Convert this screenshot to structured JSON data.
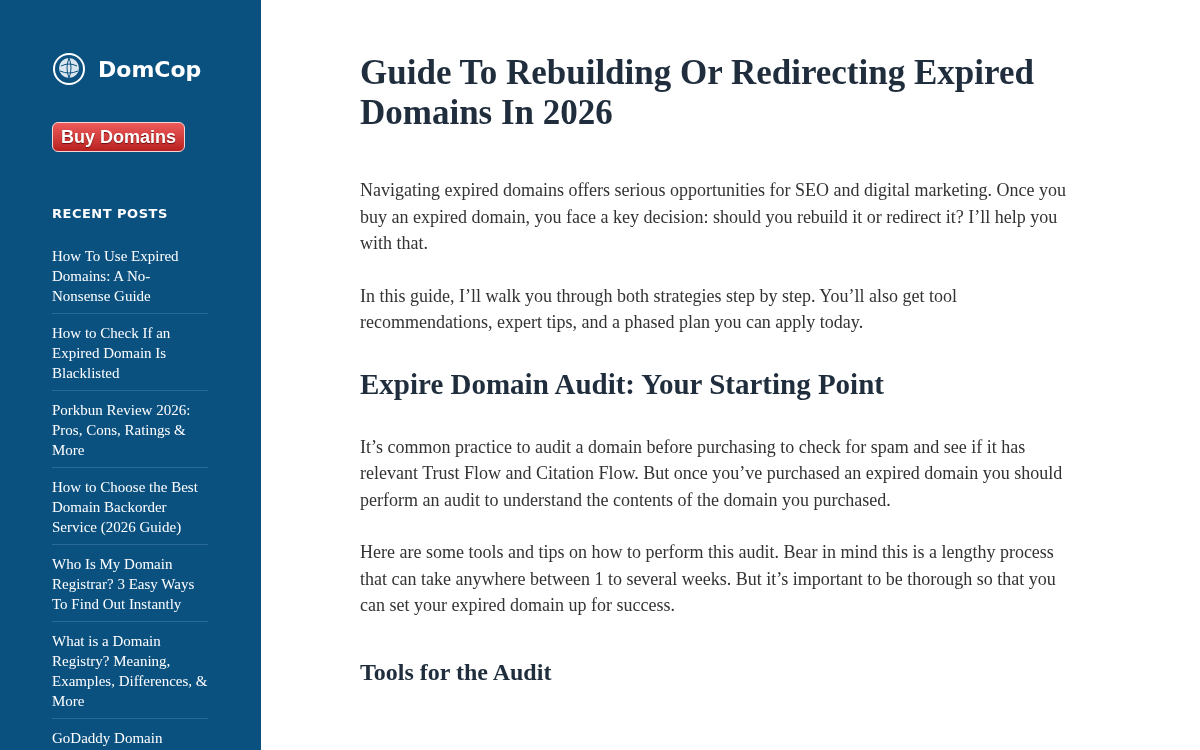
{
  "sidebar": {
    "brand": "DomCop",
    "cta_button": "Buy Domains",
    "recent_posts_heading": "RECENT POSTS",
    "recent_posts": [
      "How To Use Expired Domains: A No-Nonsense Guide",
      "How to Check If an Expired Domain Is Blacklisted",
      "Porkbun Review 2026: Pros, Cons, Ratings & More",
      "How to Choose the Best Domain Backorder Service (2026 Guide)",
      "Who Is My Domain Registrar? 3 Easy Ways To Find Out Instantly",
      "What is a Domain Registry? Meaning, Examples, Differences, & More",
      "GoDaddy Domain"
    ]
  },
  "article": {
    "title": "Guide To Rebuilding Or Redirecting Expired Domains In 2026",
    "blocks": [
      {
        "kind": "paragraph",
        "text": "Navigating expired domains offers serious opportunities for SEO and digital marketing. Once you buy an expired domain, you face a key decision: should you rebuild it or redirect it? I’ll help you with that."
      },
      {
        "kind": "paragraph",
        "text": "In this guide, I’ll walk you through both strategies step by step. You’ll also get tool recommendations, expert tips, and a phased plan you can apply today."
      },
      {
        "kind": "heading",
        "text": "Expire Domain Audit: Your Starting Point"
      },
      {
        "kind": "paragraph",
        "text": "It’s common practice to audit a domain before purchasing to check for spam and see if it has relevant Trust Flow and Citation Flow. But once you’ve purchased an expired domain you should perform an audit to understand the contents of the domain you purchased."
      },
      {
        "kind": "paragraph",
        "text": "Here are some tools and tips on how to perform this audit. Bear in mind this is a lengthy process that can take anywhere between 1 to several weeks. But it’s important to be thorough so that you can set your expired domain up for success."
      },
      {
        "kind": "subheading",
        "text": "Tools for the Audit"
      }
    ]
  }
}
